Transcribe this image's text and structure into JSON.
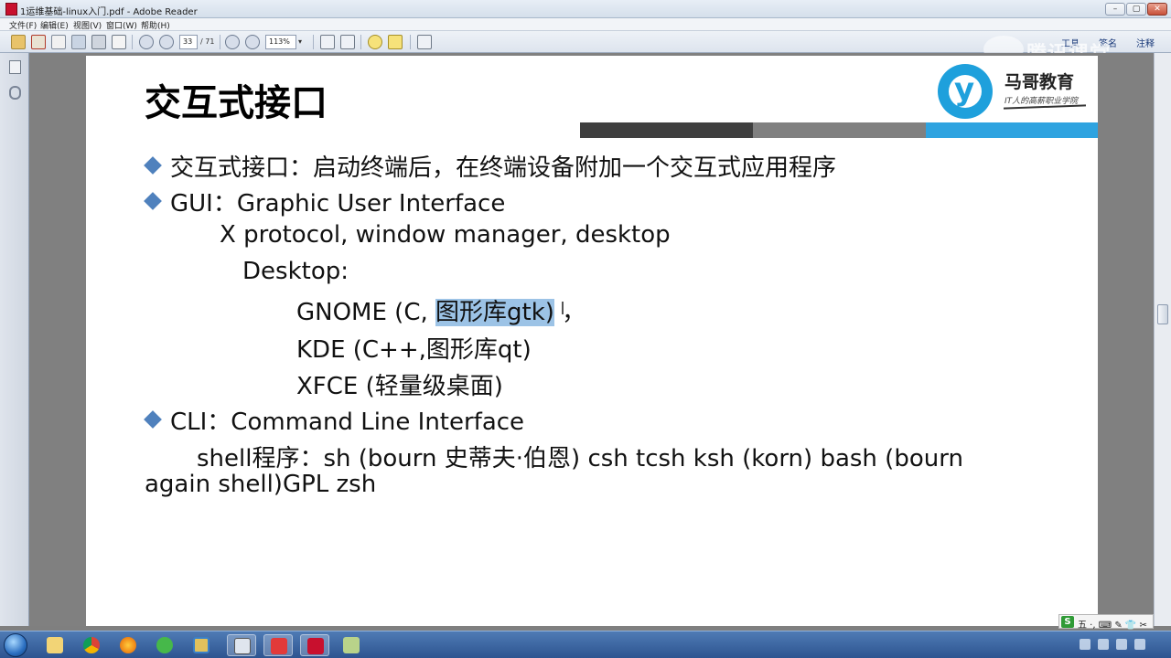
{
  "window": {
    "title": "1运维基础-linux入门.pdf - Adobe Reader",
    "controls": {
      "minimize": "–",
      "maximize": "▢",
      "close": "✕"
    }
  },
  "menu": {
    "items": [
      "文件(F)",
      "编辑(E)",
      "视图(V)",
      "窗口(W)",
      "帮助(H)"
    ]
  },
  "toolbar": {
    "page_current": "33",
    "page_total": "/ 71",
    "zoom": "113%",
    "right_items": [
      "工具",
      "签名",
      "注释"
    ]
  },
  "watermark": {
    "text": "腾讯课堂"
  },
  "slide": {
    "title": "交互式接口",
    "logo": {
      "glyph": "y",
      "name": "马哥教育",
      "tagline": "IT人的高薪职业学院"
    },
    "colors": {
      "bar_dark": "#3f3f3f",
      "bar_gray": "#808080",
      "bar_blue": "#2ea3e0",
      "bullet": "#4f81bd",
      "highlight": "#9cc3e6"
    },
    "lines": {
      "l1": "交互式接口：启动终端后，在终端设备附加一个交互式应用程序",
      "l2": "GUI：Graphic User Interface",
      "l3": "X protocol, window manager, desktop",
      "l4": "Desktop:",
      "l5_pre": "GNOME (C, ",
      "l5_hl": "图形库gtk)",
      "l5_post": " ，",
      "l6": "KDE   (C++,图形库qt)",
      "l7": "XFCE  (轻量级桌面)",
      "l8": "CLI：Command Line Interface",
      "l9": "shell程序：sh (bourn 史蒂夫·伯恩) csh     tcsh    ksh (korn)     bash (bourn",
      "l10": "again shell)GPL  zsh"
    }
  },
  "ime": {
    "logo": "S",
    "text": "五 ·,  ⌨ ✎ 👕 ✂"
  }
}
